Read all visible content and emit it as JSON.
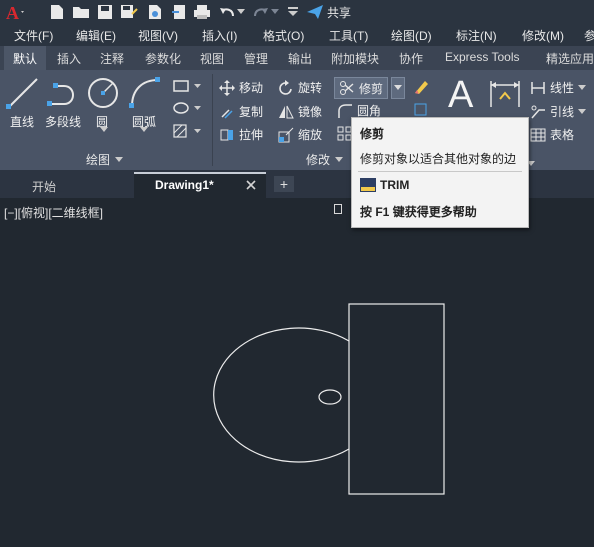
{
  "quick_access": {
    "share_label": "共享"
  },
  "menu": [
    "文件(F)",
    "编辑(E)",
    "视图(V)",
    "插入(I)",
    "格式(O)",
    "工具(T)",
    "绘图(D)",
    "标注(N)",
    "修改(M)",
    "参"
  ],
  "ribbon_tabs": [
    "默认",
    "插入",
    "注释",
    "参数化",
    "视图",
    "管理",
    "输出",
    "附加模块",
    "协作",
    "Express Tools",
    "精选应用"
  ],
  "draw_panel": {
    "line": "直线",
    "polyline": "多段线",
    "circle": "圆",
    "arc": "圆弧",
    "label": "绘图"
  },
  "modify_panel": {
    "move": "移动",
    "rotate": "旋转",
    "trim": "修剪",
    "copy": "复制",
    "mirror": "镜像",
    "fillet": "圆角",
    "stretch": "拉伸",
    "scale": "缩放",
    "label": "修改"
  },
  "annotation_panel": {
    "text_glyph": "A",
    "linear": "线性",
    "leader": "引线",
    "table": "表格"
  },
  "doc_tabs": {
    "start": "开始",
    "drawing": "Drawing1*",
    "add": "+"
  },
  "viewport": {
    "label": "[−][俯视][二维线框]"
  },
  "tooltip": {
    "title": "修剪",
    "description": "修剪对象以适合其他对象的边",
    "command": "TRIM",
    "help_prefix": "按 ",
    "help_key": "F1",
    "help_suffix": " 键获得更多帮助"
  },
  "colors": {
    "accent": "#c9252c",
    "ribbon": "#4a5466",
    "canvas": "#212830",
    "tooltip_bg": "#f3f3f3"
  }
}
